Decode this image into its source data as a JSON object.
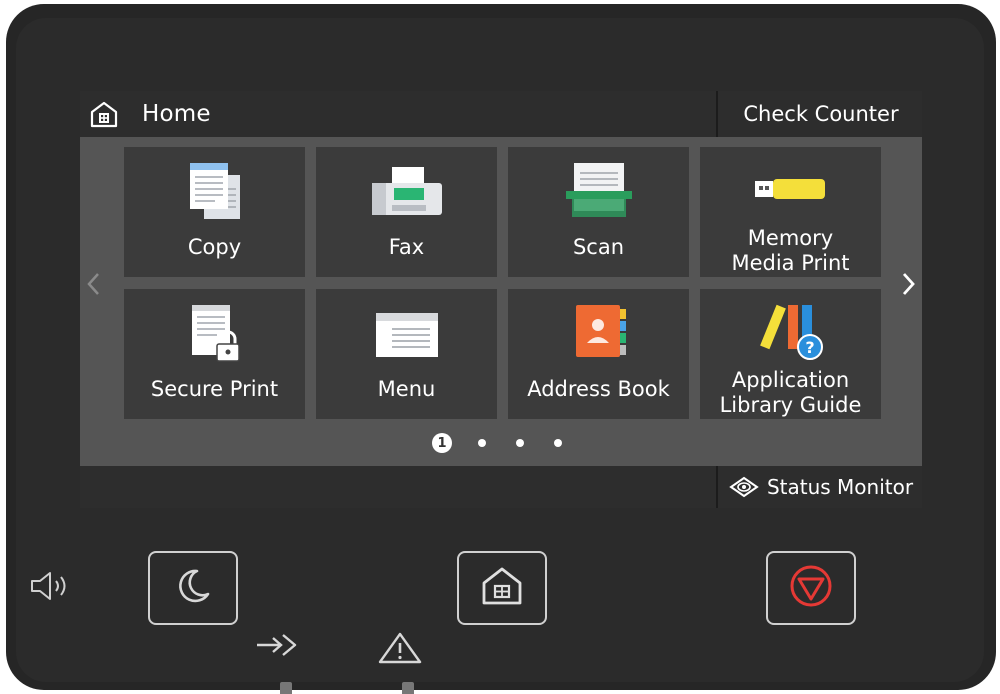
{
  "screen": {
    "title": "Home",
    "check_counter": "Check Counter",
    "status_monitor": "Status Monitor",
    "page_indicator": {
      "current": "1",
      "total_pages": 4
    }
  },
  "tiles": [
    {
      "label": "Copy",
      "icon": "copy-icon"
    },
    {
      "label": "Fax",
      "icon": "fax-icon"
    },
    {
      "label": "Scan",
      "icon": "scan-icon"
    },
    {
      "label_line1": "Memory",
      "label_line2": "Media Print",
      "icon": "usb-memory-icon"
    },
    {
      "label": "Secure Print",
      "icon": "secure-print-icon"
    },
    {
      "label": "Menu",
      "icon": "menu-icon"
    },
    {
      "label": "Address Book",
      "icon": "address-book-icon"
    },
    {
      "label_line1": "Application",
      "label_line2": "Library Guide",
      "icon": "application-library-icon"
    }
  ],
  "hardware": {
    "buttons": [
      "sleep-button",
      "home-button",
      "stop-button"
    ],
    "indicators": [
      "data-indicator",
      "error-indicator"
    ],
    "speaker": "speaker-icon"
  },
  "colors": {
    "device_body": "#262626",
    "screen_bg": "#555555",
    "tile_bg": "#3b3b3b",
    "bar_bg": "#2d2d2d",
    "stop_red": "#e53935",
    "fax_green": "#2ab573",
    "scan_green": "#2a9d5c",
    "usb_yellow": "#f4df3a",
    "address_orange": "#ee6a33",
    "help_blue": "#2a8fdc"
  }
}
